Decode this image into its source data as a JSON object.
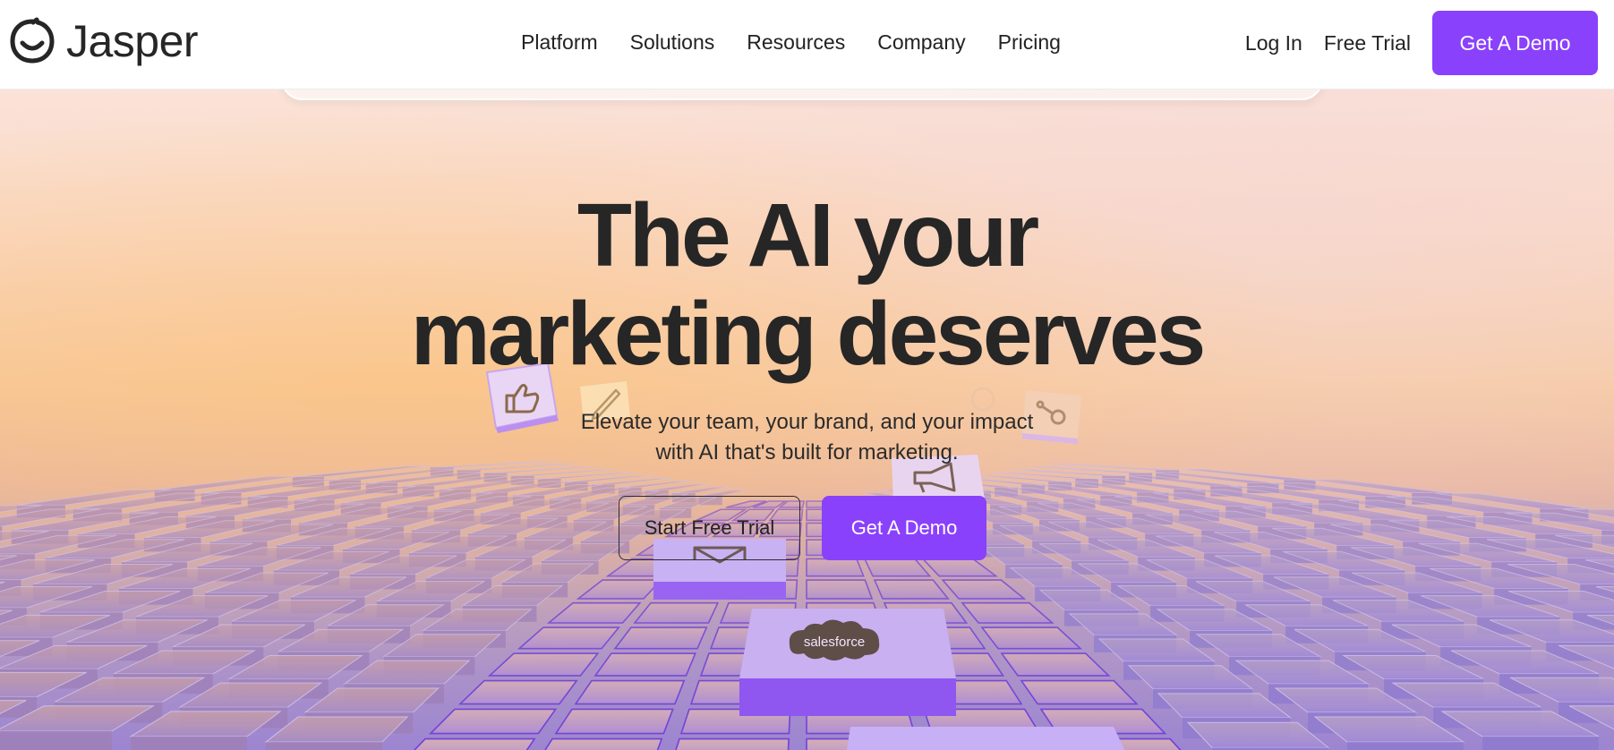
{
  "brand": {
    "name": "Jasper",
    "accent_color": "#8a41fb"
  },
  "nav": {
    "links": [
      "Platform",
      "Solutions",
      "Resources",
      "Company",
      "Pricing"
    ],
    "login_label": "Log In",
    "free_trial_label": "Free Trial",
    "demo_label": "Get A Demo"
  },
  "hero": {
    "headline_line1": "The AI your",
    "headline_line2": "marketing deserves",
    "subtext_line1": "Elevate your team, your brand, and your impact",
    "subtext_line2": "with AI that's built for marketing.",
    "cta_trial_label": "Start Free Trial",
    "cta_demo_label": "Get A Demo"
  },
  "floating_icons": [
    "thumbs-up-icon",
    "pencil-icon",
    "megaphone-icon",
    "mail-icon",
    "hubspot-icon",
    "salesforce-logo"
  ],
  "salesforce_logo_text": "salesforce"
}
